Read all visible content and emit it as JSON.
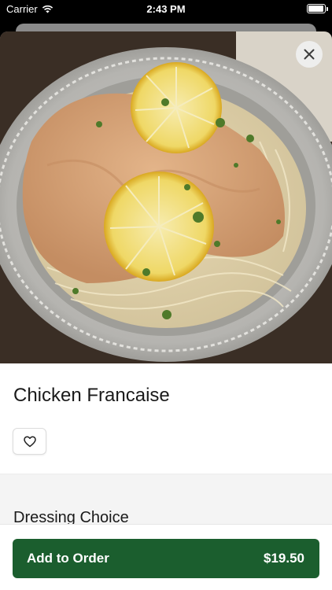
{
  "status_bar": {
    "carrier": "Carrier",
    "time": "2:43 PM",
    "battery_level": 0.95
  },
  "item": {
    "name": "Chicken Francaise",
    "image_alt": "Chicken Francaise with lemon slices over pasta in a foil tray"
  },
  "icons": {
    "close": "close-icon",
    "favorite": "heart-outline-icon",
    "wifi": "wifi-icon"
  },
  "options": {
    "section_title": "Dressing Choice"
  },
  "order_button": {
    "label": "Add to Order",
    "price": "$19.50"
  },
  "colors": {
    "primary": "#1b5e2e",
    "background": "#ffffff",
    "section": "#f4f4f4"
  }
}
